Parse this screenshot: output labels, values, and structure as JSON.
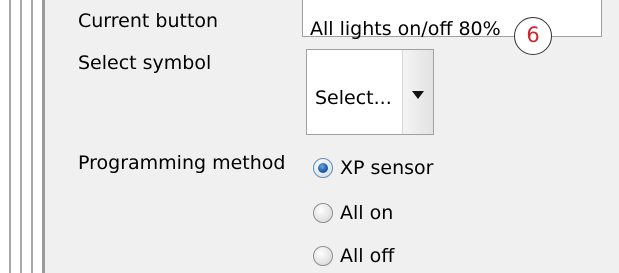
{
  "form": {
    "current_button": {
      "label": "Current button",
      "value": "All lights on/off 80%"
    },
    "step_marker": "6",
    "select_symbol": {
      "label": "Select symbol",
      "value": "Select...",
      "arrow_icon": "triangle-down-icon"
    },
    "programming_method": {
      "label": "Programming method",
      "options": [
        {
          "label": "XP sensor",
          "checked": true
        },
        {
          "label": "All on",
          "checked": false
        },
        {
          "label": "All off",
          "checked": false
        }
      ]
    }
  },
  "colors": {
    "panel_background": "#f0f0f0",
    "step_marker_text": "#d0262b",
    "radio_selected": "#1e5fa8"
  }
}
